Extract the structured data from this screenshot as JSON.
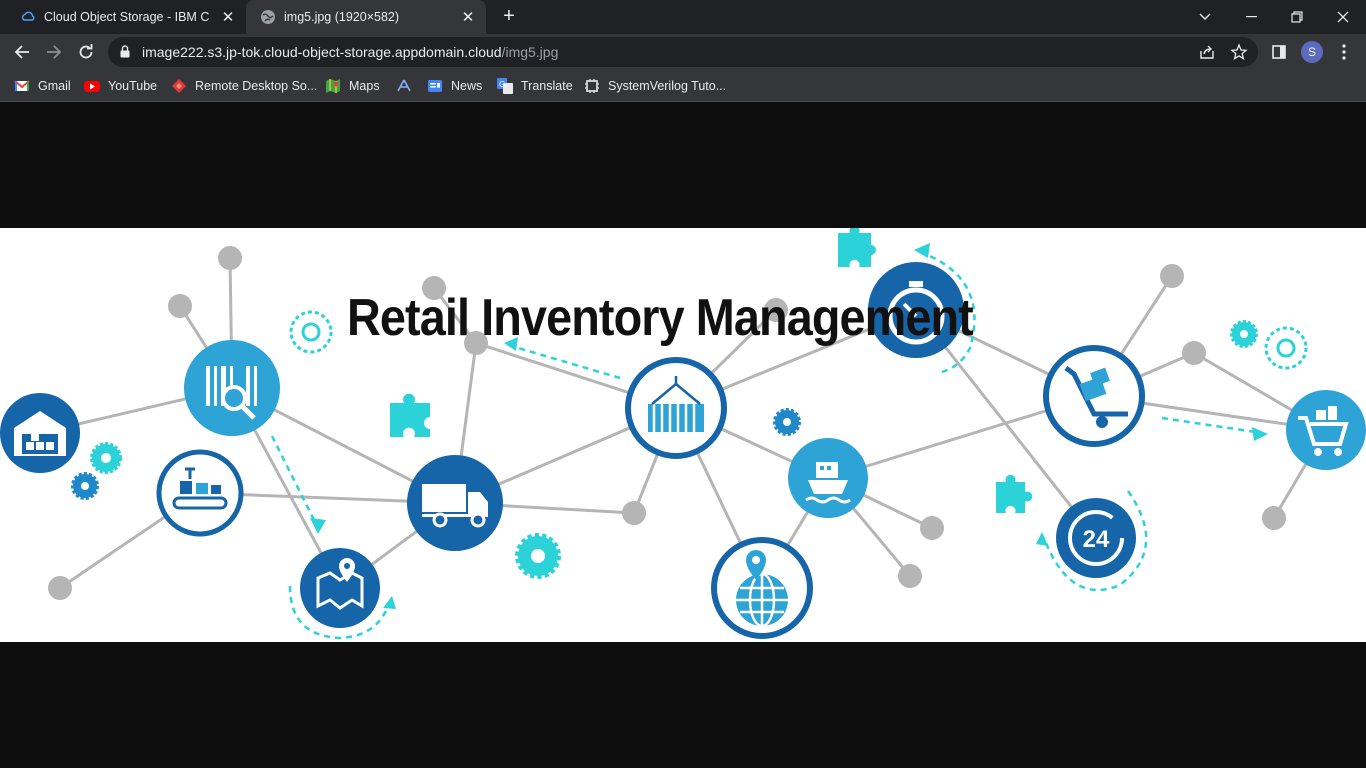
{
  "browser": {
    "tabs": [
      {
        "title": "Cloud Object Storage - IBM Cloud",
        "favicon": "ibm-cloud-icon",
        "active": false
      },
      {
        "title": "img5.jpg (1920×582)",
        "favicon": "globe-icon",
        "active": true
      }
    ],
    "new_tab_label": "+",
    "address": {
      "host": "image222.s3.jp-tok.cloud-object-storage.appdomain.cloud",
      "path": "/img5.jpg"
    },
    "profile_initial": "S",
    "bookmarks": [
      {
        "label": "Gmail",
        "icon": "gmail-icon"
      },
      {
        "label": "YouTube",
        "icon": "youtube-icon"
      },
      {
        "label": "Remote Desktop So...",
        "icon": "remote-desktop-icon"
      },
      {
        "label": "Maps",
        "icon": "maps-icon"
      },
      {
        "label": "",
        "icon": "drive-icon"
      },
      {
        "label": "News",
        "icon": "news-icon"
      },
      {
        "label": "Translate",
        "icon": "translate-icon"
      },
      {
        "label": "SystemVerilog Tuto...",
        "icon": "chip-icon"
      }
    ]
  },
  "image": {
    "title": "Retail Inventory Management",
    "icon_nodes": [
      "warehouse",
      "barcode-search",
      "conveyor",
      "map-pin",
      "delivery-truck",
      "shipping-container",
      "stopwatch",
      "cargo-ship",
      "globe-location",
      "hand-truck",
      "24-hour",
      "shopping-cart"
    ],
    "colors": {
      "dark_blue": "#1565a8",
      "light_blue": "#2ea3d6",
      "cyan": "#2bd3d8",
      "gray": "#b3b3b3"
    }
  }
}
